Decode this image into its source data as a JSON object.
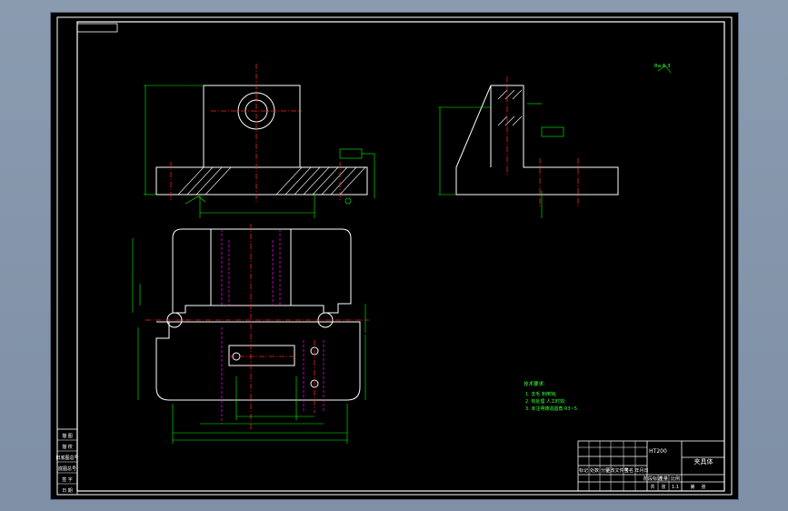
{
  "drawing": {
    "title": "夹具体",
    "material": "HT200",
    "scale_note": "Ra 6.3",
    "technical_requirements": {
      "heading": "技术要求:",
      "items": [
        "1. 去毛 刺倒钝;",
        "2. 热处理 人工时效;",
        "3. 未注明铸造圆角 R3~5."
      ]
    },
    "left_strip_labels": [
      "描 图",
      "描 校",
      "旧底图总号",
      "底图总号",
      "签 字",
      "日 期"
    ],
    "title_block": {
      "row_labels": [
        "标记",
        "处数",
        "分区",
        "更改文件号",
        "签名",
        "年月日"
      ],
      "stage_labels": [
        "阶段标记",
        "重量",
        "比例"
      ],
      "sheet_labels": [
        "共",
        "张",
        "第",
        "张"
      ],
      "scale_value": "1:1"
    },
    "colors": {
      "outline": "#ffffff",
      "dimension": "#00ff00",
      "centerline": "#ff2020",
      "hidden": "#ff00ff",
      "hatch": "#ffffff"
    }
  }
}
